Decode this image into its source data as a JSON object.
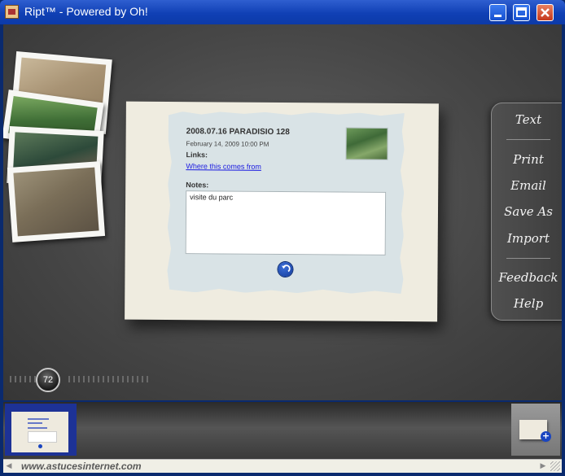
{
  "window": {
    "title": "Ript™ - Powered by Oh!",
    "controls": [
      "minimize-icon",
      "maximize-icon",
      "close-icon"
    ]
  },
  "note_card": {
    "title": "2008.07.16 PARADISIO 128",
    "date": "February 14, 2009 10:00 PM",
    "links_label": "Links:",
    "link_text": "Where this comes from",
    "notes_label": "Notes:",
    "notes_value": "visite du parc",
    "back_icon": "flip-back-icon"
  },
  "side_menu": {
    "items": [
      {
        "label": "Text"
      },
      {
        "label": "Print"
      },
      {
        "label": "Email"
      },
      {
        "label": "Save As"
      },
      {
        "label": "Import"
      },
      {
        "label": "Feedback"
      },
      {
        "label": "Help"
      }
    ]
  },
  "counter": {
    "value": "72"
  },
  "filmstrip": {
    "add_icon": "add-card-icon"
  },
  "statusbar": {
    "watermark": "www.astucesinternet.com"
  },
  "colors": {
    "accent": "#1040b5",
    "link": "#1a1ae0",
    "card_bg": "#efece0",
    "note_bg": "#d9e3e6"
  }
}
